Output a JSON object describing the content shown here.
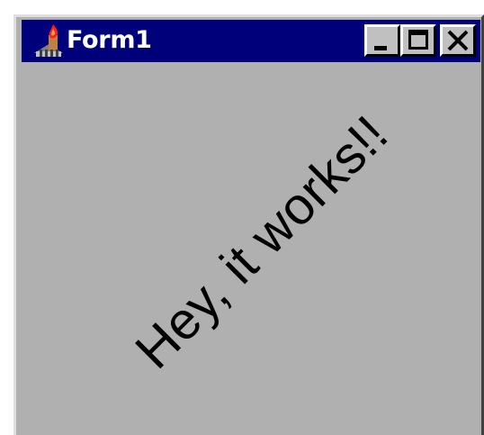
{
  "window": {
    "title": "Form1",
    "icon": "app-icon",
    "controls": {
      "minimize_icon": "minimize-icon",
      "maximize_icon": "maximize-icon",
      "close_icon": "close-icon"
    }
  },
  "client": {
    "message": "Hey, it works!!",
    "background_color": "#b0b0b0"
  },
  "colors": {
    "title_bar": "#00007b",
    "title_text": "#ffffff",
    "button_face": "#c0c0c0"
  }
}
